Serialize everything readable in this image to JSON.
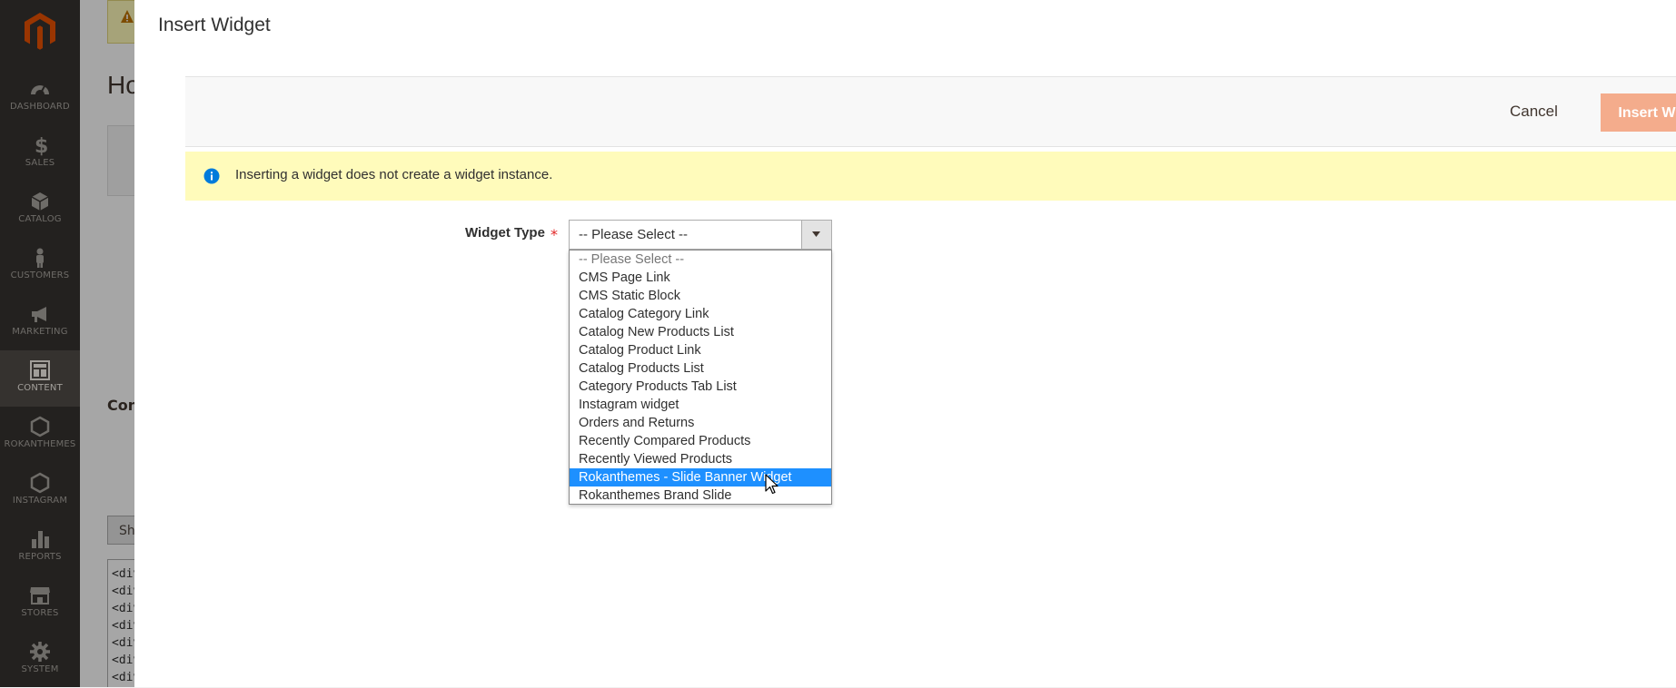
{
  "sidebar": {
    "items": [
      {
        "label": "DASHBOARD",
        "icon": "dashboard-icon"
      },
      {
        "label": "SALES",
        "icon": "dollar-icon"
      },
      {
        "label": "CATALOG",
        "icon": "box-icon"
      },
      {
        "label": "CUSTOMERS",
        "icon": "person-icon"
      },
      {
        "label": "MARKETING",
        "icon": "megaphone-icon"
      },
      {
        "label": "CONTENT",
        "icon": "layout-icon",
        "active": true
      },
      {
        "label": "ROKANTHEMES",
        "icon": "hexagon-icon"
      },
      {
        "label": "INSTAGRAM",
        "icon": "hexagon-icon"
      },
      {
        "label": "REPORTS",
        "icon": "bar-chart-icon"
      },
      {
        "label": "STORES",
        "icon": "store-icon"
      },
      {
        "label": "SYSTEM",
        "icon": "gear-icon"
      }
    ]
  },
  "background_page": {
    "title": "Ho",
    "section": "Con",
    "show_button": "Sh",
    "code_lines": [
      "<div",
      "<div",
      "<div",
      "<div",
      "<div",
      "<div",
      "<div"
    ]
  },
  "modal": {
    "title": "Insert Widget",
    "cancel_label": "Cancel",
    "insert_label": "Insert Widget",
    "notice": "Inserting a widget does not create a widget instance.",
    "field_label": "Widget Type",
    "required_mark": "*",
    "select_value": "-- Please Select --",
    "options": [
      "-- Please Select --",
      "CMS Page Link",
      "CMS Static Block",
      "Catalog Category Link",
      "Catalog New Products List",
      "Catalog Product Link",
      "Catalog Products List",
      "Category Products Tab List",
      "Instagram widget",
      "Orders and Returns",
      "Recently Compared Products",
      "Recently Viewed Products",
      "Rokanthemes - Slide Banner Widget",
      "Rokanthemes Brand Slide"
    ]
  },
  "colors": {
    "sidebar_bg": "#373330",
    "accent_orange": "#f4ac8c",
    "notice_bg": "#fffbbb",
    "highlight": "#1e90ff"
  }
}
